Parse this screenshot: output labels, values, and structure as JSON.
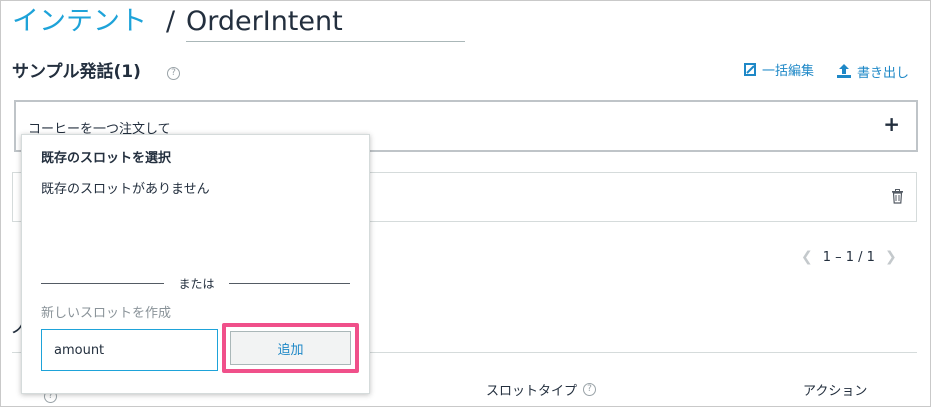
{
  "header": {
    "breadcrumb_link": "インテント",
    "separator": "/",
    "intent_name": "OrderIntent"
  },
  "utterances": {
    "title": "サンプル発話(1)",
    "help_icon": "?",
    "bulk_edit_label": "一括編集",
    "export_label": "書き出し",
    "input_value": "コーヒーを一つ注文して",
    "add_icon": "+",
    "pagination": "1 – 1 / 1"
  },
  "slot_table": {
    "column_slot_type": "スロットタイプ",
    "column_action": "アクション"
  },
  "popover": {
    "title": "既存のスロットを選択",
    "empty_message": "既存のスロットがありません",
    "or_label": "または",
    "new_slot_label": "新しいスロットを作成",
    "slot_input_value": "amount",
    "add_button_label": "追加"
  },
  "colors": {
    "link": "#1ea3d9",
    "highlight": "#f0508a",
    "text": "#232f3e"
  }
}
